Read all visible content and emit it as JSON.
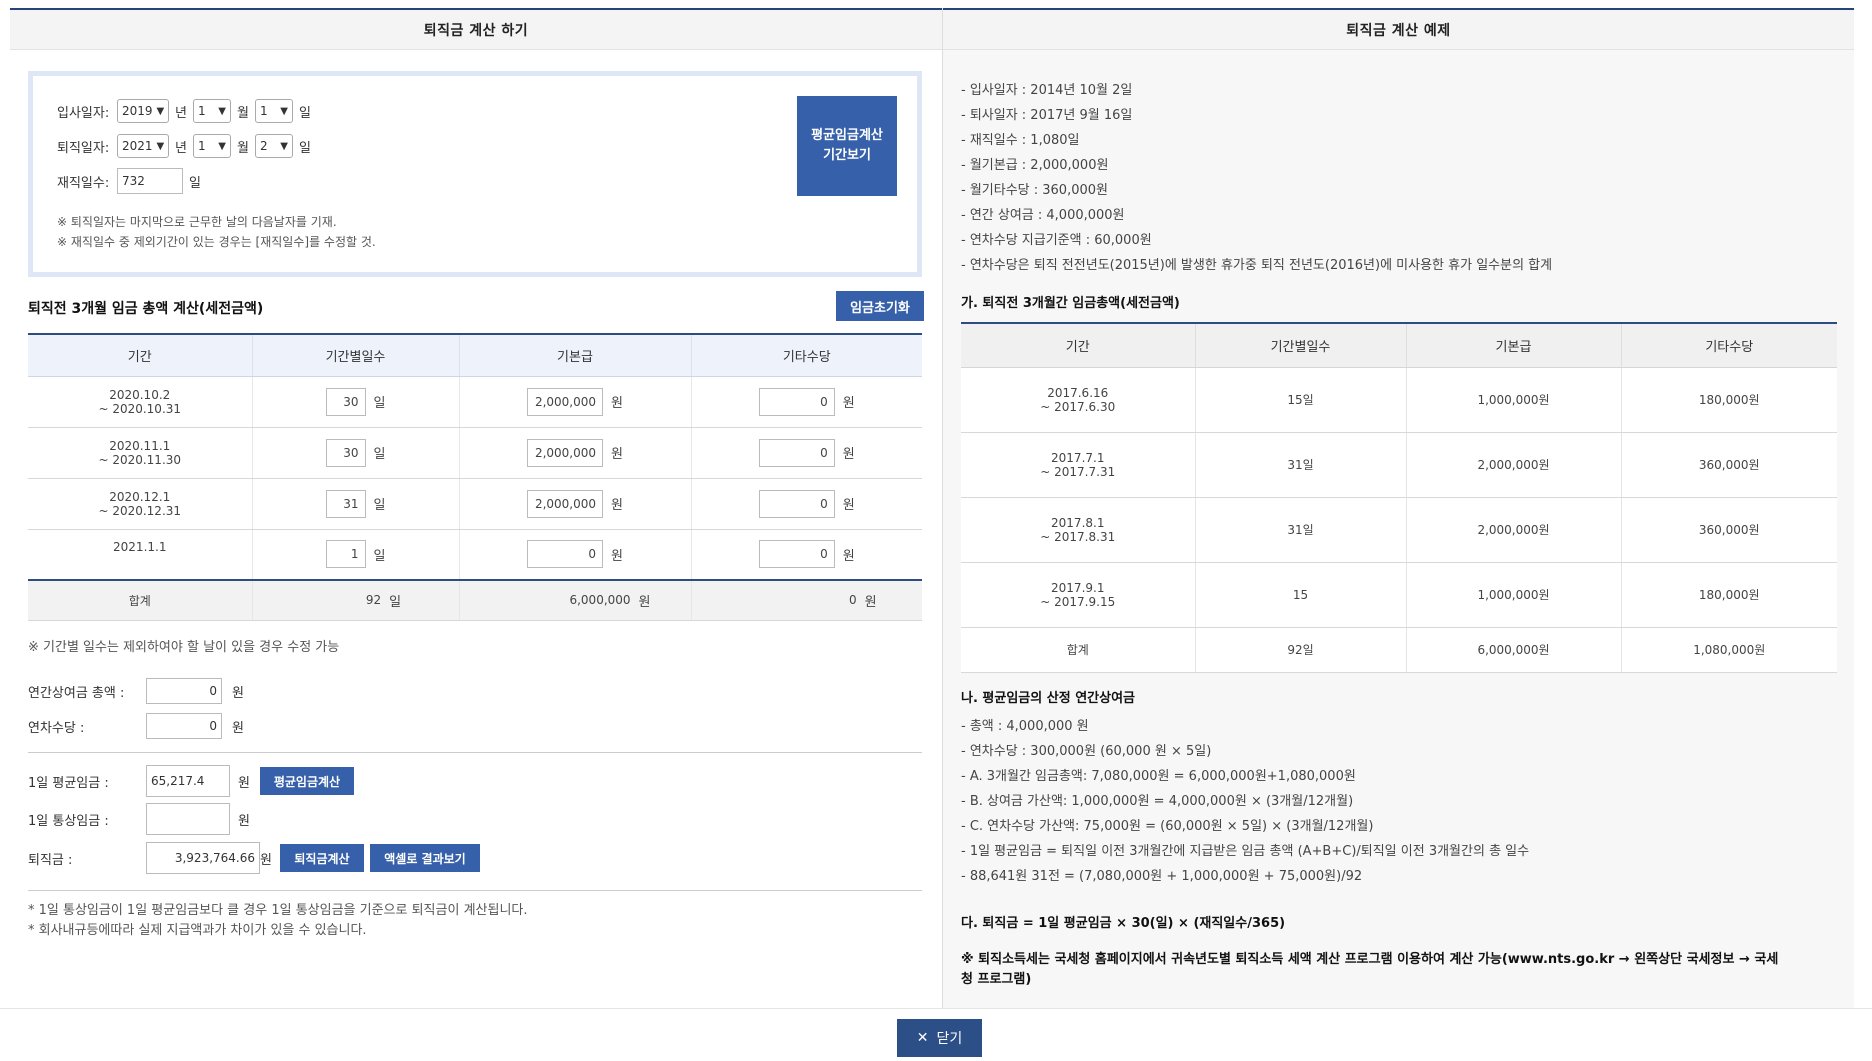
{
  "left": {
    "title": "퇴직금 계산 하기",
    "hire": {
      "label": "입사일자:",
      "year": "2019",
      "month": "1",
      "day": "1"
    },
    "retire": {
      "label": "퇴직일자:",
      "year": "2021",
      "month": "1",
      "day": "2"
    },
    "units": {
      "year": "년",
      "month": "월",
      "day": "일",
      "won": "원"
    },
    "tenure": {
      "label": "재직일수:",
      "value": "732",
      "unit": "일"
    },
    "notes": [
      "※ 퇴직일자는 마지막으로 근무한 날의 다음날자를 기재.",
      "※ 재직일수 중 제외기간이 있는 경우는 [재직일수]를 수정할 것."
    ],
    "period_button": {
      "line1": "평균임금계산",
      "line2": "기간보기"
    },
    "section_title": "퇴직전 3개월 임금 총액 계산(세전금액)",
    "reset_button": "임금초기화",
    "table": {
      "headers": [
        "기간",
        "기간별일수",
        "기본급",
        "기타수당"
      ],
      "rows": [
        {
          "period1": "2020.10.2",
          "period2": "~ 2020.10.31",
          "days": "30",
          "base": "2,000,000",
          "other": "0"
        },
        {
          "period1": "2020.11.1",
          "period2": "~ 2020.11.30",
          "days": "30",
          "base": "2,000,000",
          "other": "0"
        },
        {
          "period1": "2020.12.1",
          "period2": "~ 2020.12.31",
          "days": "31",
          "base": "2,000,000",
          "other": "0"
        },
        {
          "period1": "2021.1.1",
          "period2": "",
          "days": "1",
          "base": "0",
          "other": "0"
        }
      ],
      "sum": {
        "label": "합계",
        "days": "92",
        "base": "6,000,000",
        "other": "0"
      }
    },
    "table_note": "※ 기간별 일수는 제외하여야 할 날이 있을 경우 수정 가능",
    "bonus": {
      "label": "연간상여금 총액 :",
      "value": "0"
    },
    "leave": {
      "label": "연차수당 :",
      "value": "0"
    },
    "avg_wage": {
      "label": "1일 평균임금 :",
      "value": "65,217.4",
      "button": "평균임금계산"
    },
    "ordinary_wage": {
      "label": "1일 통상임금 :",
      "value": ""
    },
    "severance": {
      "label": "퇴직금 :",
      "value": "3,923,764.66",
      "button": "퇴직금계산",
      "excel_button": "액셀로 결과보기"
    },
    "footer_notes": [
      "* 1일 통상임금이 1일 평균임금보다 클 경우 1일 통상임금을 기준으로 퇴직금이 계산됩니다.",
      "* 회사내규등에따라 실제 지급액과가 차이가 있을 수 있습니다."
    ]
  },
  "right": {
    "title": "퇴직금 계산 예제",
    "bullets": [
      "- 입사일자 : 2014년 10월 2일",
      "- 퇴사일자 : 2017년 9월 16일",
      "- 재직일수 : 1,080일",
      "- 월기본급 : 2,000,000원",
      "- 월기타수당 : 360,000원",
      "- 연간 상여금 : 4,000,000원",
      "- 연차수당 지급기준액 : 60,000원",
      "- 연차수당은 퇴직 전전년도(2015년)에 발생한 휴가중 퇴직 전년도(2016년)에 미사용한 휴가 일수분의 합계"
    ],
    "section_a": "가. 퇴직전 3개월간 임금총액(세전금액)",
    "table": {
      "headers": [
        "기간",
        "기간별일수",
        "기본급",
        "기타수당"
      ],
      "rows": [
        {
          "period1": "2017.6.16",
          "period2": "~ 2017.6.30",
          "days": "15일",
          "base": "1,000,000원",
          "other": "180,000원"
        },
        {
          "period1": "2017.7.1",
          "period2": "~ 2017.7.31",
          "days": "31일",
          "base": "2,000,000원",
          "other": "360,000원"
        },
        {
          "period1": "2017.8.1",
          "period2": "~ 2017.8.31",
          "days": "31일",
          "base": "2,000,000원",
          "other": "360,000원"
        },
        {
          "period1": "2017.9.1",
          "period2": "~ 2017.9.15",
          "days": "15",
          "base": "1,000,000원",
          "other": "180,000원"
        }
      ],
      "sum": {
        "label": "합계",
        "days": "92일",
        "base": "6,000,000원",
        "other": "1,080,000원"
      }
    },
    "section_b": "나. 평균임금의 산정 연간상여금",
    "b_lines": [
      "- 총액 : 4,000,000 원",
      "- 연차수당 : 300,000원 (60,000 원 × 5일)",
      "- A. 3개월간 임금총액: 7,080,000원 = 6,000,000원+1,080,000원",
      "- B. 상여금 가산액: 1,000,000원 = 4,000,000원 × (3개월/12개월)",
      "- C. 연차수당 가산액: 75,000원 = (60,000원 × 5일) × (3개월/12개월)",
      "- 1일 평균임금 = 퇴직일 이전 3개월간에 지급받은 임금 총액 (A+B+C)/퇴직일 이전 3개월간의 총 일수",
      "- 88,641원 31전 = (7,080,000원 + 1,000,000원 + 75,000원)/92"
    ],
    "section_c": "다. 퇴직금 = 1일 평균임금 × 30(일) × (재직일수/365)",
    "tax_note_line1": "※ 퇴직소득세는 국세청 홈페이지에서 귀속년도별 퇴직소득 세액 계산 프로그램 이용하여 계산 가능(www.nts.go.kr → 왼쪽상단 국세정보 → 국세",
    "tax_note_line2": "청 프로그램)"
  },
  "close_button": "닫기"
}
